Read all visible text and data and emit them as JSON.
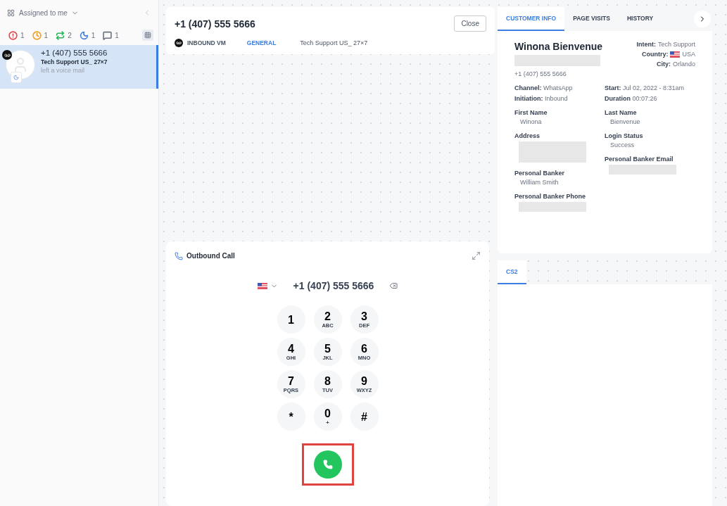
{
  "sidebar": {
    "filter_label": "Assigned to me",
    "counters": [
      {
        "kind": "alert",
        "count": "1",
        "color": "#e5484d"
      },
      {
        "kind": "clock",
        "count": "1",
        "color": "#f0a020"
      },
      {
        "kind": "repeat",
        "count": "2",
        "color": "#2fb45a"
      },
      {
        "kind": "moon",
        "count": "1",
        "color": "#4a7fe0"
      },
      {
        "kind": "message",
        "count": "1",
        "color": "#6b7280"
      }
    ],
    "conversations": [
      {
        "phone": "+1 (407) 555 5666",
        "queue": "Tech Support US_ 27×7",
        "preview": "left a voice mail",
        "selected": true
      }
    ]
  },
  "conversation": {
    "title": "+1 (407) 555 5666",
    "close": "Close",
    "channel": "INBOUND VM",
    "category": "GENERAL",
    "queue": "Tech Support US_ 27×7"
  },
  "dialer": {
    "title": "Outbound Call",
    "number": "+1 (407) 555 5666",
    "keys": [
      {
        "digit": "1"
      },
      {
        "digit": "2",
        "letters": "ABC"
      },
      {
        "digit": "3",
        "letters": "DEF"
      },
      {
        "digit": "4",
        "letters": "GHI"
      },
      {
        "digit": "5",
        "letters": "JKL"
      },
      {
        "digit": "6",
        "letters": "MNO"
      },
      {
        "digit": "7",
        "letters": "PQRS"
      },
      {
        "digit": "8",
        "letters": "TUV"
      },
      {
        "digit": "9",
        "letters": "WXYZ"
      },
      {
        "digit": "*"
      },
      {
        "digit": "0",
        "letters": "+"
      },
      {
        "digit": "#"
      }
    ],
    "call_highlighted": true
  },
  "customer": {
    "tabs": [
      {
        "label": "CUSTOMER INFO",
        "selected": true
      },
      {
        "label": "PAGE VISITS",
        "selected": false
      },
      {
        "label": "HISTORY",
        "selected": false
      }
    ],
    "name": "Winona Bienvenue",
    "phone": "+1 (407) 555 5666",
    "meta": [
      {
        "label": "Intent:",
        "value": "Tech Support"
      },
      {
        "label": "Country:",
        "value": "USA",
        "kind": "flag"
      },
      {
        "label": "City:",
        "value": "Orlando"
      }
    ],
    "details_left": [
      {
        "label": "Channel:",
        "value": "WhatsApp"
      },
      {
        "label": "Initiation:",
        "value": "Inbound"
      }
    ],
    "details_right": [
      {
        "label": "Start:",
        "value": "Jul 02, 2022 - 8:31am"
      },
      {
        "label": "Duration",
        "value": "00:07:26"
      }
    ],
    "fields_left": [
      {
        "label": "First Name",
        "value": "Winona"
      },
      {
        "label": "Address"
      },
      {
        "label": "Personal Banker",
        "value": "William Smith"
      },
      {
        "label": "Personal Banker Phone"
      }
    ],
    "fields_right": [
      {
        "label": "Last Name",
        "value": "Bienvenue"
      },
      {
        "label": "Login Status",
        "value": "Success"
      },
      {
        "label": "Personal Banker Email"
      }
    ]
  },
  "lower_tabs": [
    {
      "label": "CS2",
      "selected": true
    }
  ]
}
